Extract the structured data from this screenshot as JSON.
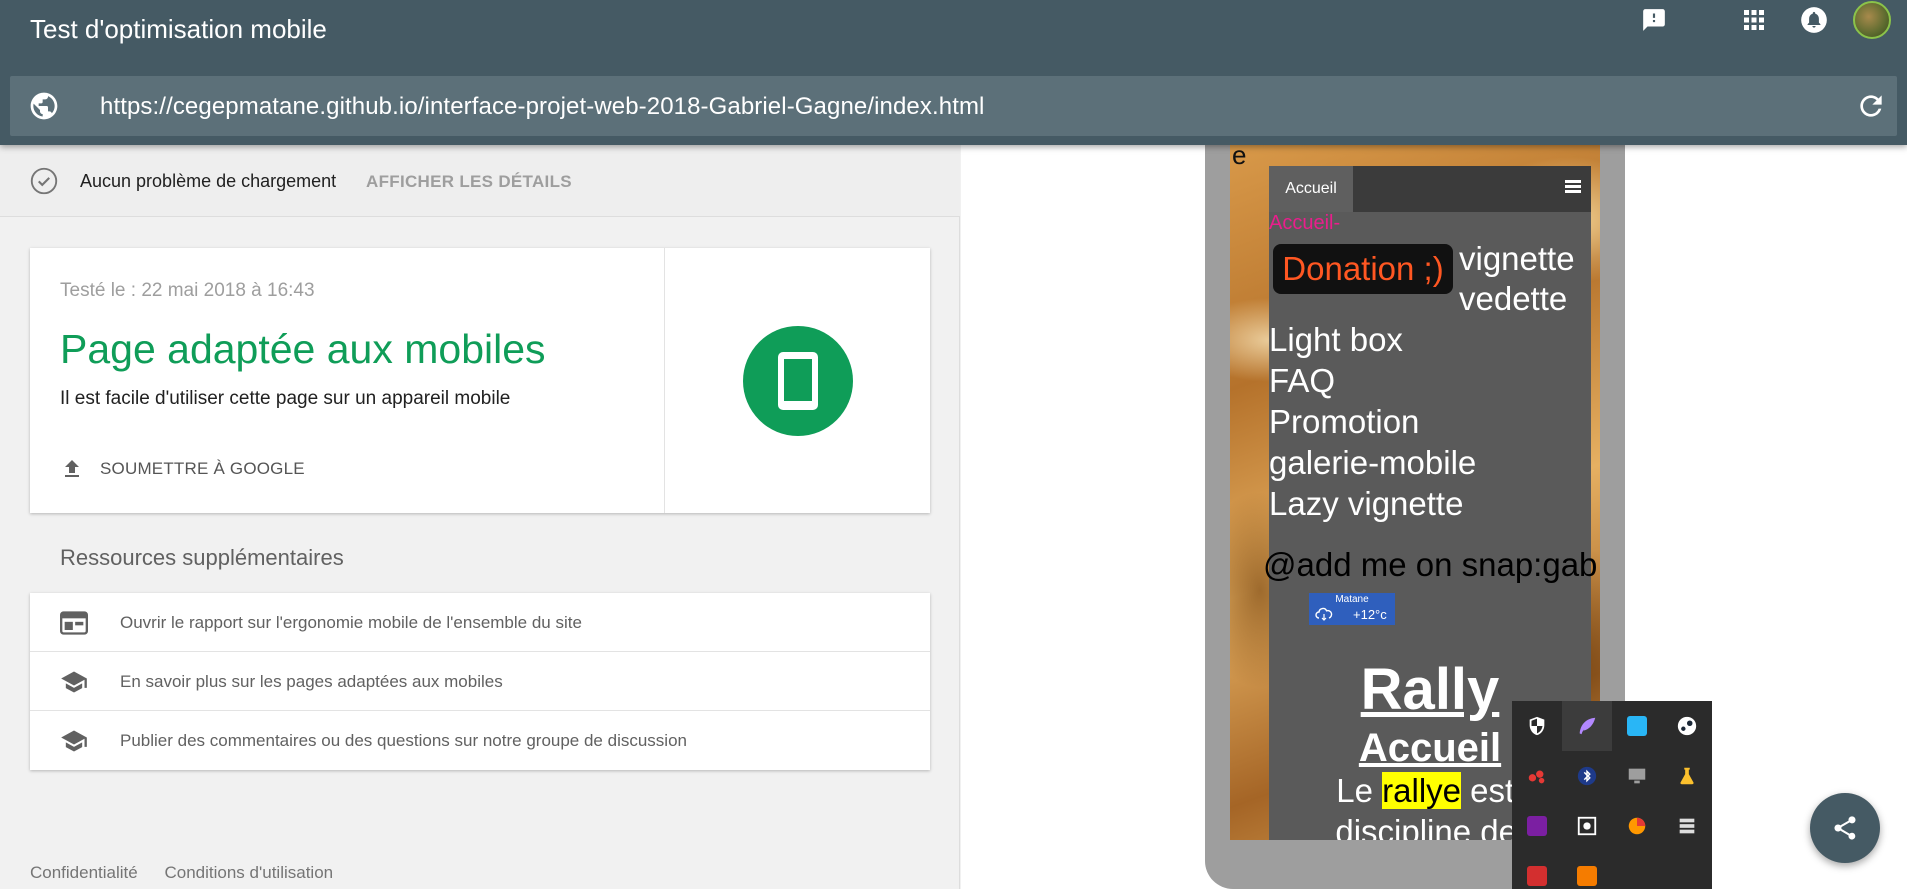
{
  "app": {
    "title": "Test d'optimisation mobile",
    "url": "https://cegepmatane.github.io/interface-projet-web-2018-Gabriel-Gagne/index.html",
    "icons": [
      "feedback-icon",
      "apps-grid-icon",
      "notifications-icon",
      "account-avatar",
      "globe-icon",
      "reload-icon"
    ]
  },
  "status": {
    "text": "Aucun problème de chargement",
    "details_link": "AFFICHER LES DÉTAILS"
  },
  "result": {
    "tested": "Testé le : 22 mai 2018 à 16:43",
    "title": "Page adaptée aux mobiles",
    "subtitle": "Il est facile d'utiliser cette page sur un appareil mobile",
    "submit_label": "SOUMETTRE À GOOGLE",
    "accent_color": "#0f9d58"
  },
  "resources": {
    "heading": "Ressources supplémentaires",
    "items": [
      {
        "label": "Ouvrir le rapport sur l'ergonomie mobile de l'ensemble du site",
        "icon": "web-report-icon"
      },
      {
        "label": "En savoir plus sur les pages adaptées aux mobiles",
        "icon": "school-icon"
      },
      {
        "label": "Publier des commentaires ou des questions sur notre groupe de discussion",
        "icon": "school-icon"
      }
    ]
  },
  "footer": {
    "privacy": "Confidentialité",
    "terms": "Conditions d'utilisation"
  },
  "preview": {
    "stray_letter": "e",
    "nav_home": "Accueil",
    "breadcrumb": "Accueil-",
    "donation": "Donation ;)",
    "links": [
      "vignette",
      "vedette",
      "Light box",
      "FAQ",
      "Promotion",
      "galerie-mobile",
      "Lazy vignette"
    ],
    "snap": "@add me on snap:gab",
    "weather": {
      "city": "Matane",
      "temp": "+12°c"
    },
    "rally": "Rally",
    "accueil": "Accueil",
    "para_line1_pre": "Le ",
    "para_line1_hl": "rallye",
    "para_line1_post": " est u",
    "para_line2": "discipline de s"
  },
  "tray": {
    "icons": [
      "defender-shield-icon",
      "feather-icon",
      "computer-icon",
      "steam-icon",
      "cluster-icon",
      "bluetooth-icon",
      "display-icon",
      "flask-icon",
      "onenote-icon",
      "gear-box-icon",
      "pie-icon",
      "stack-icon",
      "ccu-icon",
      "java-icon"
    ]
  },
  "colors": {
    "appbar": "#455a64",
    "urlbar": "#5c7079",
    "success": "#0f9d58",
    "highlight": "#ffff00"
  }
}
